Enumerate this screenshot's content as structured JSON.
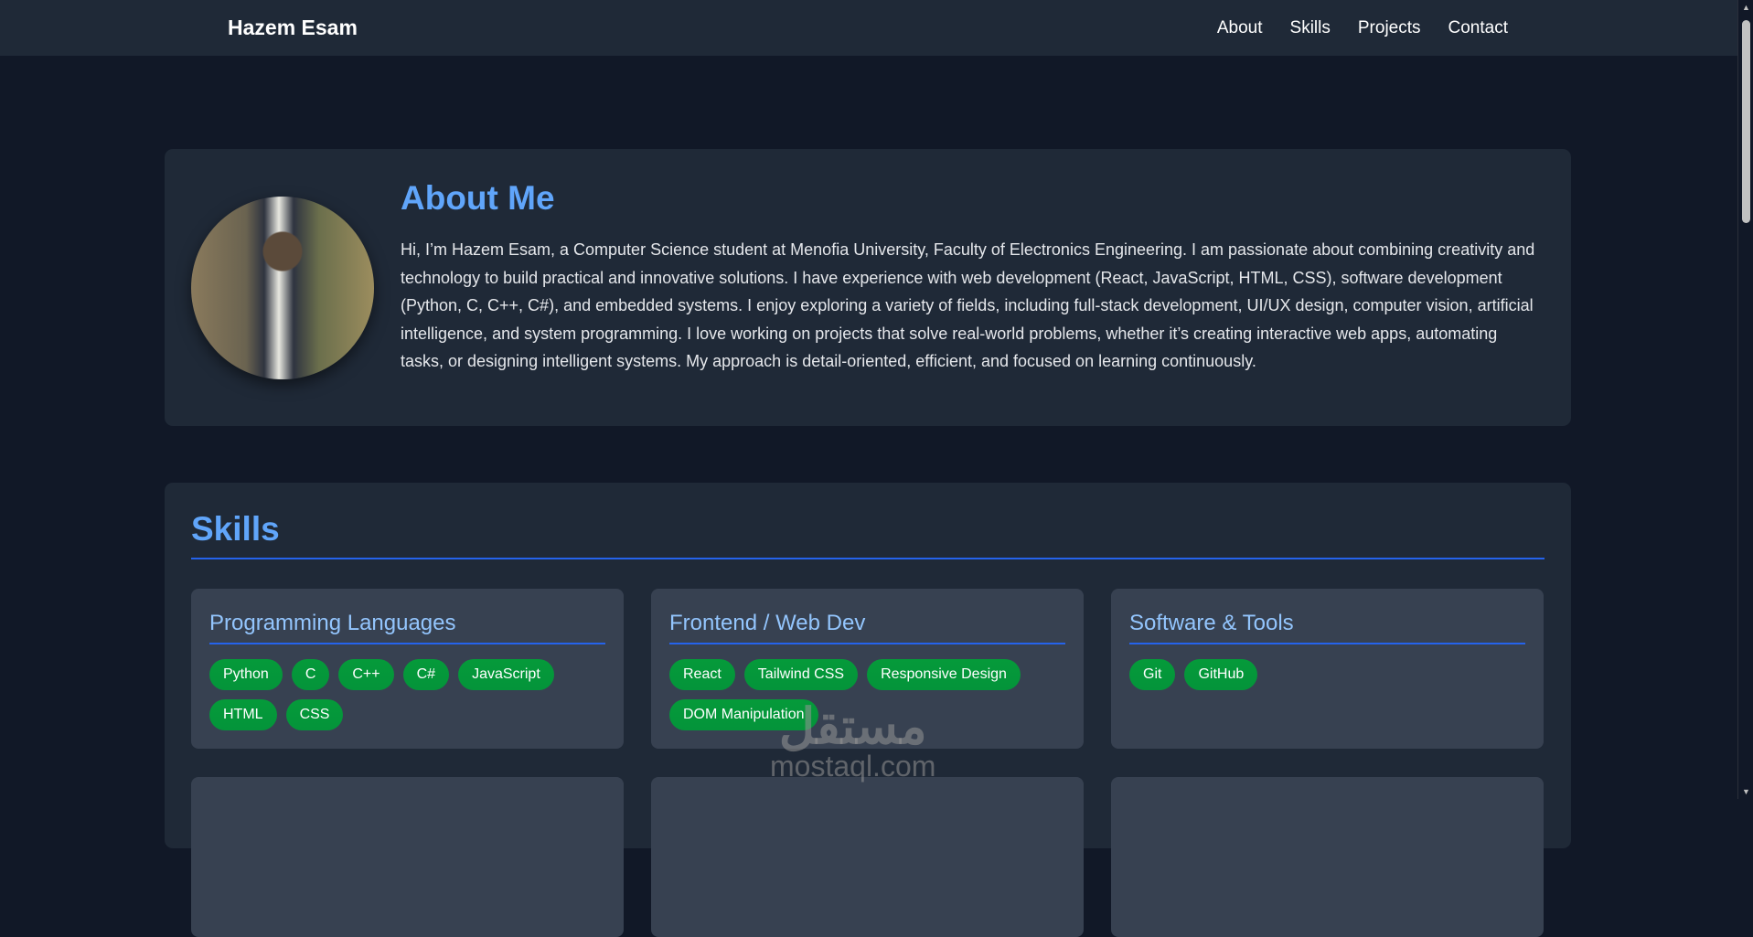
{
  "nav": {
    "brand": "Hazem Esam",
    "links": [
      "About",
      "Skills",
      "Projects",
      "Contact"
    ]
  },
  "about": {
    "title": "About Me",
    "text": "Hi, I’m Hazem Esam, a Computer Science student at Menofia University, Faculty of Electronics Engineering. I am passionate about combining creativity and technology to build practical and innovative solutions. I have experience with web development (React, JavaScript, HTML, CSS), software development (Python, C, C++, C#), and embedded systems. I enjoy exploring a variety of fields, including full-stack development, UI/UX design, computer vision, artificial intelligence, and system programming. I love working on projects that solve real-world problems, whether it’s creating interactive web apps, automating tasks, or designing intelligent systems. My approach is detail-oriented, efficient, and focused on learning continuously."
  },
  "skills": {
    "title": "Skills",
    "groups": [
      {
        "title": "Programming Languages",
        "items": [
          "Python",
          "C",
          "C++",
          "C#",
          "JavaScript",
          "HTML",
          "CSS"
        ]
      },
      {
        "title": "Frontend / Web Dev",
        "items": [
          "React",
          "Tailwind CSS",
          "Responsive Design",
          "DOM Manipulation"
        ]
      },
      {
        "title": "Software & Tools",
        "items": [
          "Git",
          "GitHub"
        ]
      }
    ]
  },
  "watermark": {
    "arabic": "مستقل",
    "latin": "mostaql.com"
  }
}
